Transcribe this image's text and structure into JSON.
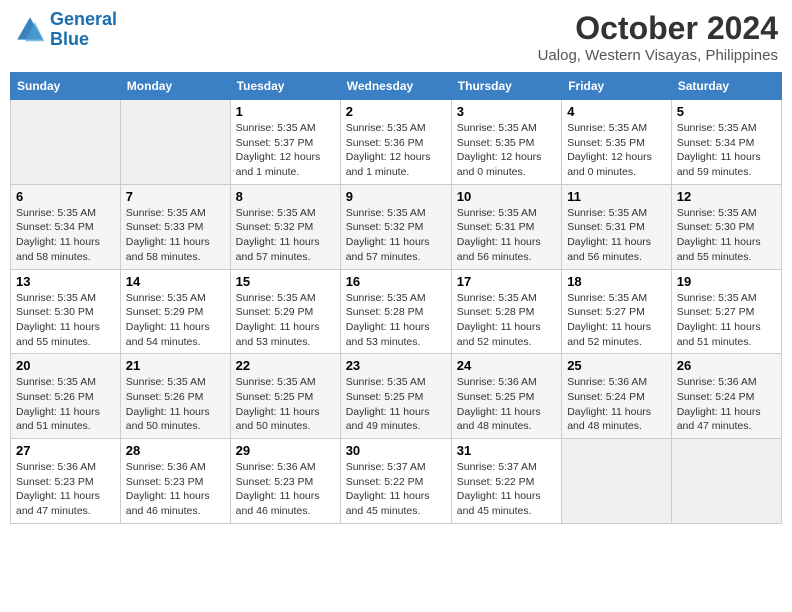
{
  "header": {
    "logo_line1": "General",
    "logo_line2": "Blue",
    "month": "October 2024",
    "location": "Ualog, Western Visayas, Philippines"
  },
  "days_of_week": [
    "Sunday",
    "Monday",
    "Tuesday",
    "Wednesday",
    "Thursday",
    "Friday",
    "Saturday"
  ],
  "weeks": [
    [
      null,
      null,
      {
        "day": "1",
        "sunrise": "Sunrise: 5:35 AM",
        "sunset": "Sunset: 5:37 PM",
        "daylight": "Daylight: 12 hours and 1 minute."
      },
      {
        "day": "2",
        "sunrise": "Sunrise: 5:35 AM",
        "sunset": "Sunset: 5:36 PM",
        "daylight": "Daylight: 12 hours and 1 minute."
      },
      {
        "day": "3",
        "sunrise": "Sunrise: 5:35 AM",
        "sunset": "Sunset: 5:35 PM",
        "daylight": "Daylight: 12 hours and 0 minutes."
      },
      {
        "day": "4",
        "sunrise": "Sunrise: 5:35 AM",
        "sunset": "Sunset: 5:35 PM",
        "daylight": "Daylight: 12 hours and 0 minutes."
      },
      {
        "day": "5",
        "sunrise": "Sunrise: 5:35 AM",
        "sunset": "Sunset: 5:34 PM",
        "daylight": "Daylight: 11 hours and 59 minutes."
      }
    ],
    [
      {
        "day": "6",
        "sunrise": "Sunrise: 5:35 AM",
        "sunset": "Sunset: 5:34 PM",
        "daylight": "Daylight: 11 hours and 58 minutes."
      },
      {
        "day": "7",
        "sunrise": "Sunrise: 5:35 AM",
        "sunset": "Sunset: 5:33 PM",
        "daylight": "Daylight: 11 hours and 58 minutes."
      },
      {
        "day": "8",
        "sunrise": "Sunrise: 5:35 AM",
        "sunset": "Sunset: 5:32 PM",
        "daylight": "Daylight: 11 hours and 57 minutes."
      },
      {
        "day": "9",
        "sunrise": "Sunrise: 5:35 AM",
        "sunset": "Sunset: 5:32 PM",
        "daylight": "Daylight: 11 hours and 57 minutes."
      },
      {
        "day": "10",
        "sunrise": "Sunrise: 5:35 AM",
        "sunset": "Sunset: 5:31 PM",
        "daylight": "Daylight: 11 hours and 56 minutes."
      },
      {
        "day": "11",
        "sunrise": "Sunrise: 5:35 AM",
        "sunset": "Sunset: 5:31 PM",
        "daylight": "Daylight: 11 hours and 56 minutes."
      },
      {
        "day": "12",
        "sunrise": "Sunrise: 5:35 AM",
        "sunset": "Sunset: 5:30 PM",
        "daylight": "Daylight: 11 hours and 55 minutes."
      }
    ],
    [
      {
        "day": "13",
        "sunrise": "Sunrise: 5:35 AM",
        "sunset": "Sunset: 5:30 PM",
        "daylight": "Daylight: 11 hours and 55 minutes."
      },
      {
        "day": "14",
        "sunrise": "Sunrise: 5:35 AM",
        "sunset": "Sunset: 5:29 PM",
        "daylight": "Daylight: 11 hours and 54 minutes."
      },
      {
        "day": "15",
        "sunrise": "Sunrise: 5:35 AM",
        "sunset": "Sunset: 5:29 PM",
        "daylight": "Daylight: 11 hours and 53 minutes."
      },
      {
        "day": "16",
        "sunrise": "Sunrise: 5:35 AM",
        "sunset": "Sunset: 5:28 PM",
        "daylight": "Daylight: 11 hours and 53 minutes."
      },
      {
        "day": "17",
        "sunrise": "Sunrise: 5:35 AM",
        "sunset": "Sunset: 5:28 PM",
        "daylight": "Daylight: 11 hours and 52 minutes."
      },
      {
        "day": "18",
        "sunrise": "Sunrise: 5:35 AM",
        "sunset": "Sunset: 5:27 PM",
        "daylight": "Daylight: 11 hours and 52 minutes."
      },
      {
        "day": "19",
        "sunrise": "Sunrise: 5:35 AM",
        "sunset": "Sunset: 5:27 PM",
        "daylight": "Daylight: 11 hours and 51 minutes."
      }
    ],
    [
      {
        "day": "20",
        "sunrise": "Sunrise: 5:35 AM",
        "sunset": "Sunset: 5:26 PM",
        "daylight": "Daylight: 11 hours and 51 minutes."
      },
      {
        "day": "21",
        "sunrise": "Sunrise: 5:35 AM",
        "sunset": "Sunset: 5:26 PM",
        "daylight": "Daylight: 11 hours and 50 minutes."
      },
      {
        "day": "22",
        "sunrise": "Sunrise: 5:35 AM",
        "sunset": "Sunset: 5:25 PM",
        "daylight": "Daylight: 11 hours and 50 minutes."
      },
      {
        "day": "23",
        "sunrise": "Sunrise: 5:35 AM",
        "sunset": "Sunset: 5:25 PM",
        "daylight": "Daylight: 11 hours and 49 minutes."
      },
      {
        "day": "24",
        "sunrise": "Sunrise: 5:36 AM",
        "sunset": "Sunset: 5:25 PM",
        "daylight": "Daylight: 11 hours and 48 minutes."
      },
      {
        "day": "25",
        "sunrise": "Sunrise: 5:36 AM",
        "sunset": "Sunset: 5:24 PM",
        "daylight": "Daylight: 11 hours and 48 minutes."
      },
      {
        "day": "26",
        "sunrise": "Sunrise: 5:36 AM",
        "sunset": "Sunset: 5:24 PM",
        "daylight": "Daylight: 11 hours and 47 minutes."
      }
    ],
    [
      {
        "day": "27",
        "sunrise": "Sunrise: 5:36 AM",
        "sunset": "Sunset: 5:23 PM",
        "daylight": "Daylight: 11 hours and 47 minutes."
      },
      {
        "day": "28",
        "sunrise": "Sunrise: 5:36 AM",
        "sunset": "Sunset: 5:23 PM",
        "daylight": "Daylight: 11 hours and 46 minutes."
      },
      {
        "day": "29",
        "sunrise": "Sunrise: 5:36 AM",
        "sunset": "Sunset: 5:23 PM",
        "daylight": "Daylight: 11 hours and 46 minutes."
      },
      {
        "day": "30",
        "sunrise": "Sunrise: 5:37 AM",
        "sunset": "Sunset: 5:22 PM",
        "daylight": "Daylight: 11 hours and 45 minutes."
      },
      {
        "day": "31",
        "sunrise": "Sunrise: 5:37 AM",
        "sunset": "Sunset: 5:22 PM",
        "daylight": "Daylight: 11 hours and 45 minutes."
      },
      null,
      null
    ]
  ]
}
